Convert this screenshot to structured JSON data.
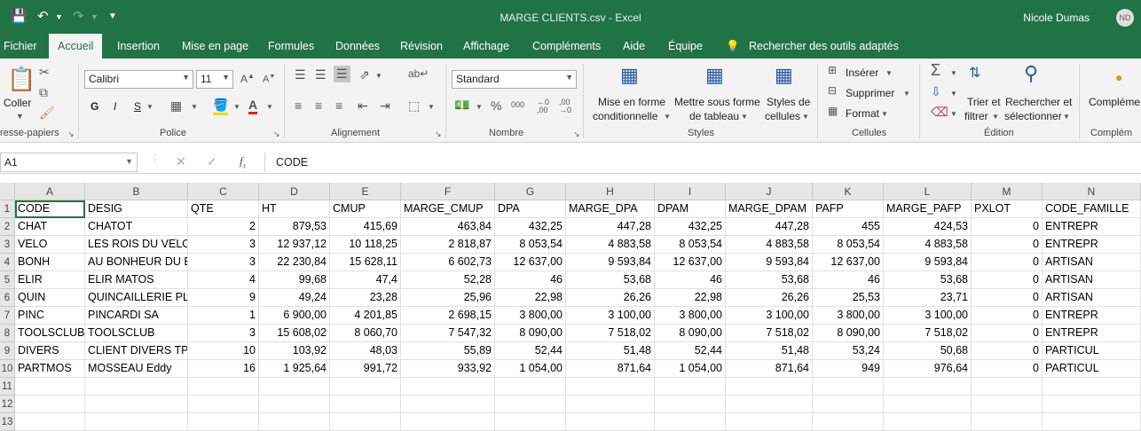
{
  "titlebar": {
    "title": "MARGE CLIENTS.csv  -  Excel",
    "user": "Nicole Dumas",
    "avatar": "ND"
  },
  "tabs": [
    "Fichier",
    "Accueil",
    "Insertion",
    "Mise en page",
    "Formules",
    "Données",
    "Révision",
    "Affichage",
    "Compléments",
    "Aide",
    "Équipe",
    "Rechercher des outils adaptés"
  ],
  "ribbon": {
    "clipboard": {
      "paste": "Coller",
      "label": "resse-papiers"
    },
    "font": {
      "name": "Calibri",
      "size": "11",
      "bold": "G",
      "italic": "I",
      "underline": "S",
      "label": "Police"
    },
    "alignment": {
      "label": "Alignement"
    },
    "number": {
      "format": "Standard",
      "label": "Nombre"
    },
    "styles": {
      "conditional": [
        "Mise en forme",
        "conditionnelle"
      ],
      "table": [
        "Mettre sous forme",
        "de tableau"
      ],
      "cell": [
        "Styles de",
        "cellules"
      ],
      "label": "Styles"
    },
    "cells": {
      "insert": "Insérer",
      "delete": "Supprimer",
      "format": "Format",
      "label": "Cellules"
    },
    "editing": {
      "sort": [
        "Trier et",
        "filtrer"
      ],
      "find": [
        "Rechercher et",
        "sélectionner"
      ],
      "label": "Édition"
    },
    "addins": {
      "button": "Compléme",
      "label": "Complém"
    }
  },
  "formula": {
    "namebox": "A1",
    "content": "CODE"
  },
  "columns": [
    "A",
    "B",
    "C",
    "D",
    "E",
    "F",
    "G",
    "H",
    "I",
    "J",
    "K",
    "L",
    "M",
    "N"
  ],
  "rows": [
    [
      "CODE",
      "DESIG",
      "QTE",
      "HT",
      "CMUP",
      "MARGE_CMUP",
      "DPA",
      "MARGE_DPA",
      "DPAM",
      "MARGE_DPAM",
      "PAFP",
      "MARGE_PAFP",
      "PXLOT",
      "CODE_FAMILLE"
    ],
    [
      "CHAT",
      "CHATOT",
      "2",
      "879,53",
      "415,69",
      "463,84",
      "432,25",
      "447,28",
      "432,25",
      "447,28",
      "455",
      "424,53",
      "0",
      "ENTREPR"
    ],
    [
      "VELO",
      "LES ROIS DU VELO",
      "3",
      "12 937,12",
      "10 118,25",
      "2 818,87",
      "8 053,54",
      "4 883,58",
      "8 053,54",
      "4 883,58",
      "8 053,54",
      "4 883,58",
      "0",
      "ENTREPR"
    ],
    [
      "BONH",
      "AU BONHEUR DU B",
      "3",
      "22 230,84",
      "15 628,11",
      "6 602,73",
      "12 637,00",
      "9 593,84",
      "12 637,00",
      "9 593,84",
      "12 637,00",
      "9 593,84",
      "0",
      "ARTISAN"
    ],
    [
      "ELIR",
      "ELIR MATOS",
      "4",
      "99,68",
      "47,4",
      "52,28",
      "46",
      "53,68",
      "46",
      "53,68",
      "46",
      "53,68",
      "0",
      "ARTISAN"
    ],
    [
      "QUIN",
      "QUINCAILLERIE PLU",
      "9",
      "49,24",
      "23,28",
      "25,96",
      "22,98",
      "26,26",
      "22,98",
      "26,26",
      "25,53",
      "23,71",
      "0",
      "ARTISAN"
    ],
    [
      "PINC",
      "PINCARDI SA",
      "1",
      "6 900,00",
      "4 201,85",
      "2 698,15",
      "3 800,00",
      "3 100,00",
      "3 800,00",
      "3 100,00",
      "3 800,00",
      "3 100,00",
      "0",
      "ENTREPR"
    ],
    [
      "TOOLSCLUB",
      "TOOLSCLUB",
      "3",
      "15 608,02",
      "8 060,70",
      "7 547,32",
      "8 090,00",
      "7 518,02",
      "8 090,00",
      "7 518,02",
      "8 090,00",
      "7 518,02",
      "0",
      "ENTREPR"
    ],
    [
      "DIVERS",
      "CLIENT DIVERS TPV",
      "10",
      "103,92",
      "48,03",
      "55,89",
      "52,44",
      "51,48",
      "52,44",
      "51,48",
      "53,24",
      "50,68",
      "0",
      "PARTICUL"
    ],
    [
      "PARTMOS",
      "MOSSEAU Eddy",
      "16",
      "1 925,64",
      "991,72",
      "933,92",
      "1 054,00",
      "871,64",
      "1 054,00",
      "871,64",
      "949",
      "976,64",
      "0",
      "PARTICUL"
    ],
    [
      "",
      "",
      "",
      "",
      "",
      "",
      "",
      "",
      "",
      "",
      "",
      "",
      "",
      ""
    ],
    [
      "",
      "",
      "",
      "",
      "",
      "",
      "",
      "",
      "",
      "",
      "",
      "",
      "",
      ""
    ],
    [
      "",
      "",
      "",
      "",
      "",
      "",
      "",
      "",
      "",
      "",
      "",
      "",
      "",
      ""
    ]
  ],
  "row_numbers": [
    "1",
    "2",
    "3",
    "4",
    "5",
    "6",
    "7",
    "8",
    "9",
    "10",
    "11",
    "12",
    "13"
  ],
  "colors": {
    "excel_green": "#217346",
    "ribbon_bg": "#f3f3f3",
    "header_bg": "#e6e6e6"
  }
}
